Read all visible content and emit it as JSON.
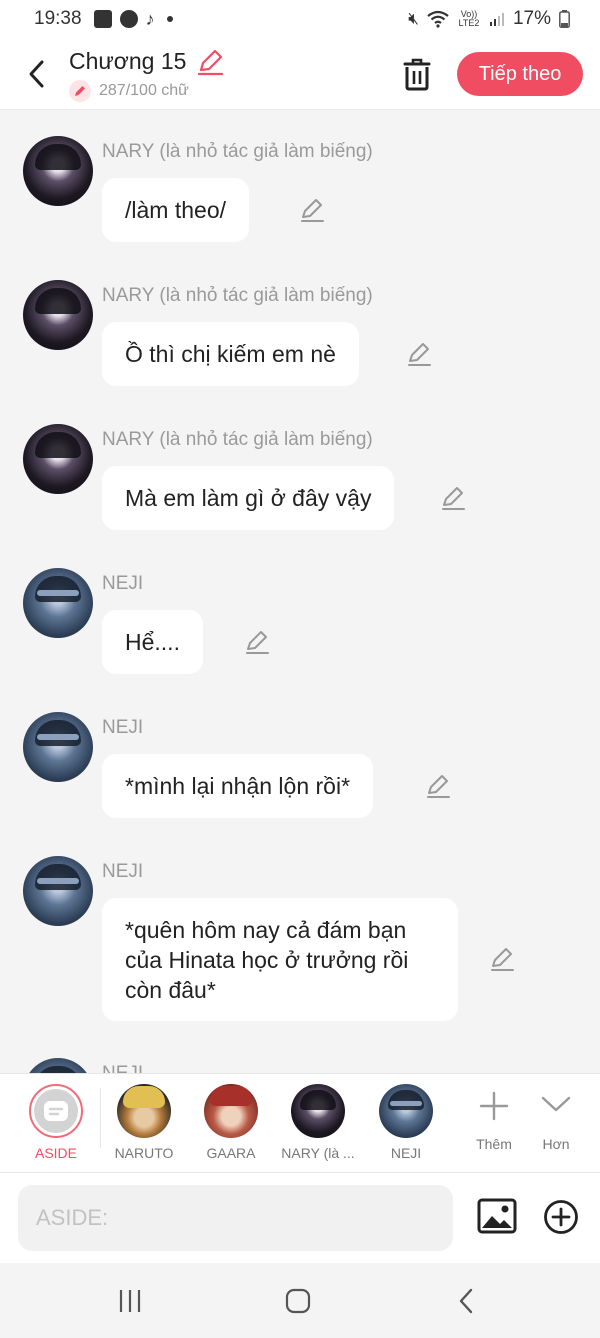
{
  "status_bar": {
    "time": "19:38",
    "network": "Vo)) LTE2",
    "battery": "17%"
  },
  "header": {
    "back_icon": "chevron-left-icon",
    "title": "Chương 15",
    "word_count": "287/100 chữ",
    "next_label": "Tiếp theo",
    "accent": "#f04d63"
  },
  "messages": [
    {
      "sender": "NARY (là nhỏ tác giả làm biếng)",
      "text": "/làm theo/",
      "avatar": "nary"
    },
    {
      "sender": "NARY (là nhỏ tác giả làm biếng)",
      "text": "Ồ thì chị kiếm em nè",
      "avatar": "nary"
    },
    {
      "sender": "NARY (là nhỏ tác giả làm biếng)",
      "text": "Mà em làm gì ở đây vậy",
      "avatar": "nary"
    },
    {
      "sender": "NEJI",
      "text": "Hể....",
      "avatar": "neji"
    },
    {
      "sender": "NEJI",
      "text": "*mình lại nhận lộn rồi*",
      "avatar": "neji"
    },
    {
      "sender": "NEJI",
      "lines": [
        "*quên hôm nay cả đám bạn",
        "của Hinata học ở trưởng rồi",
        "còn đâu*"
      ],
      "avatar": "neji"
    },
    {
      "sender": "NEJI",
      "avatar": "neji"
    }
  ],
  "cast": [
    {
      "label": "ASIDE"
    },
    {
      "label": "NARUTO"
    },
    {
      "label": "GAARA"
    },
    {
      "label": "NARY (là ..."
    },
    {
      "label": "NEJI"
    }
  ],
  "cast_actions": {
    "add_label": "Thêm",
    "more_label": "Hơn"
  },
  "composer": {
    "placeholder": "ASIDE:"
  }
}
